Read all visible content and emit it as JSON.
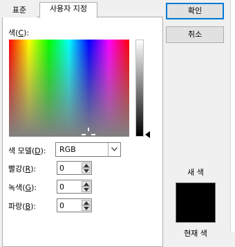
{
  "tabs": [
    {
      "label": "표준",
      "active": false
    },
    {
      "label": "사용자 지정",
      "active": true
    }
  ],
  "custom": {
    "color_label": "색(",
    "color_key": "C",
    "color_suffix": "):",
    "model_label": "색 모델(",
    "model_key": "D",
    "model_suffix": "):",
    "model_value": "RGB",
    "red_label": "빨강(",
    "red_key": "R",
    "red_suffix": "):",
    "red_value": "0",
    "green_label": "녹색(",
    "green_key": "G",
    "green_suffix": "):",
    "green_value": "0",
    "blue_label": "파랑(",
    "blue_key": "B",
    "blue_suffix": "):",
    "blue_value": "0"
  },
  "buttons": {
    "ok": "확인",
    "cancel": "취소"
  },
  "preview": {
    "new_label": "새 색",
    "current_label": "현재 색",
    "new_color": "#000000"
  }
}
